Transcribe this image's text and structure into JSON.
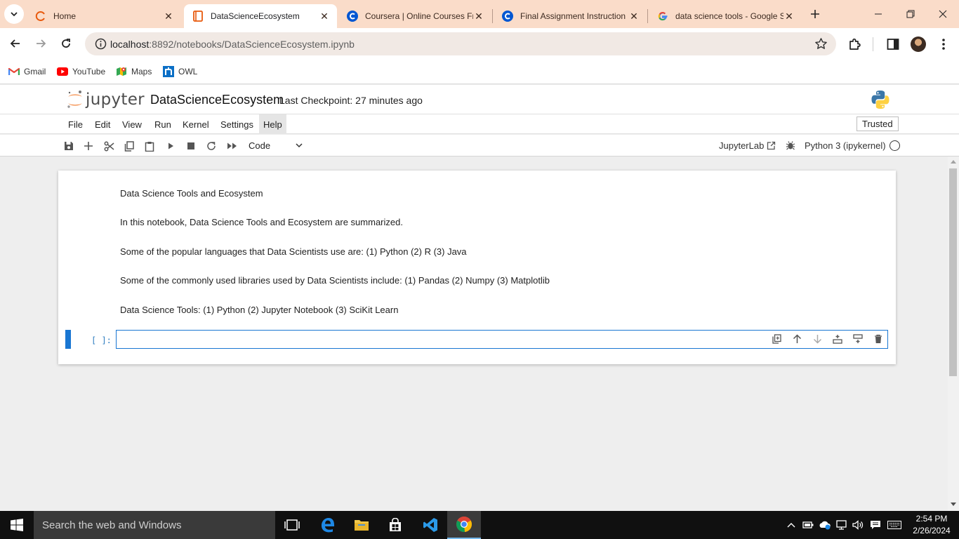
{
  "browser": {
    "tabs": [
      {
        "title": "Home",
        "icon": "coursera-spinner-icon",
        "active": false
      },
      {
        "title": "DataScienceEcosystem",
        "icon": "notebook-icon",
        "active": true
      },
      {
        "title": "Coursera | Online Courses Fr",
        "icon": "coursera-icon",
        "active": false
      },
      {
        "title": "Final Assignment Instruction",
        "icon": "coursera-icon",
        "active": false
      },
      {
        "title": "data science tools - Google S",
        "icon": "google-icon",
        "active": false
      }
    ],
    "url_host": "localhost",
    "url_path": ":8892/notebooks/DataScienceEcosystem.ipynb",
    "bookmarks": [
      {
        "label": "Gmail",
        "icon": "gmail-icon"
      },
      {
        "label": "YouTube",
        "icon": "youtube-icon"
      },
      {
        "label": "Maps",
        "icon": "maps-icon"
      },
      {
        "label": "OWL",
        "icon": "owl-icon"
      }
    ]
  },
  "jupyter": {
    "logo_text": "jupyter",
    "notebook_title": "DataScienceEcosystem",
    "checkpoint": "Last Checkpoint: 27 minutes ago",
    "menu": [
      "File",
      "Edit",
      "View",
      "Run",
      "Kernel",
      "Settings",
      "Help"
    ],
    "highlighted_menu": "Help",
    "trusted": "Trusted",
    "cell_type": "Code",
    "jupyterlab_link": "JupyterLab",
    "kernel": "Python 3 (ipykernel)",
    "markdown_lines": [
      "Data Science Tools and Ecosystem",
      "In this notebook, Data Science Tools and Ecosystem are summarized.",
      "Some of the popular languages that Data Scientists use are: (1) Python (2) R (3) Java",
      "Some of the commonly used libraries used by Data Scientists include: (1) Pandas (2) Numpy (3) Matplotlib",
      "Data Science Tools: (1) Python (2) Jupyter Notebook (3) SciKit Learn"
    ],
    "code_prompt": "[ ]:",
    "code_value": ""
  },
  "taskbar": {
    "search_placeholder": "Search the web and Windows",
    "time": "2:54 PM",
    "date": "2/26/2024"
  },
  "colors": {
    "tabstrip": "#fadcc9",
    "accent_blue": "#1976d2",
    "jupyter_orange": "#f37726"
  }
}
